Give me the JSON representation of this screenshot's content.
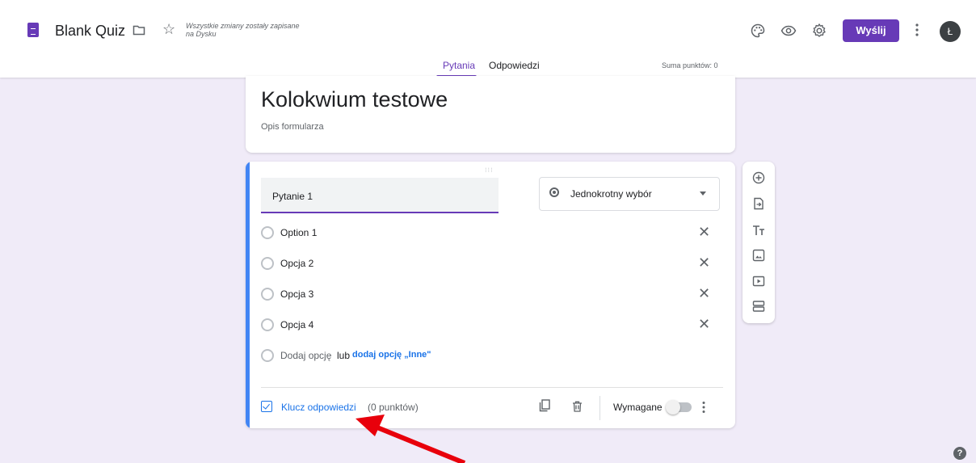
{
  "header": {
    "doc_title": "Blank Quiz",
    "save_status": "Wszystkie zmiany zostały zapisane na Dysku",
    "send_label": "Wyślij",
    "avatar_letter": "Ł",
    "tabs": [
      {
        "label": "Pytania"
      },
      {
        "label": "Odpowiedzi"
      }
    ],
    "points_total": "Suma punktów: 0"
  },
  "form": {
    "title": "Kolokwium testowe",
    "description_placeholder": "Opis formularza"
  },
  "question": {
    "title": "Pytanie 1",
    "type_label": "Jednokrotny wybór",
    "options": [
      {
        "label": "Option 1"
      },
      {
        "label": "Opcja 2"
      },
      {
        "label": "Opcja 3"
      },
      {
        "label": "Opcja 4"
      }
    ],
    "add_option": "Dodaj opcję",
    "or": "lub",
    "add_other": "dodaj opcję „Inne\"",
    "answer_key_label": "Klucz odpowiedzi",
    "points_label": "(0 punktów)",
    "required_label": "Wymagane",
    "required": false
  },
  "colors": {
    "accent": "#673ab7",
    "link": "#1a73e8",
    "annotation_arrow": "#e8000b"
  }
}
